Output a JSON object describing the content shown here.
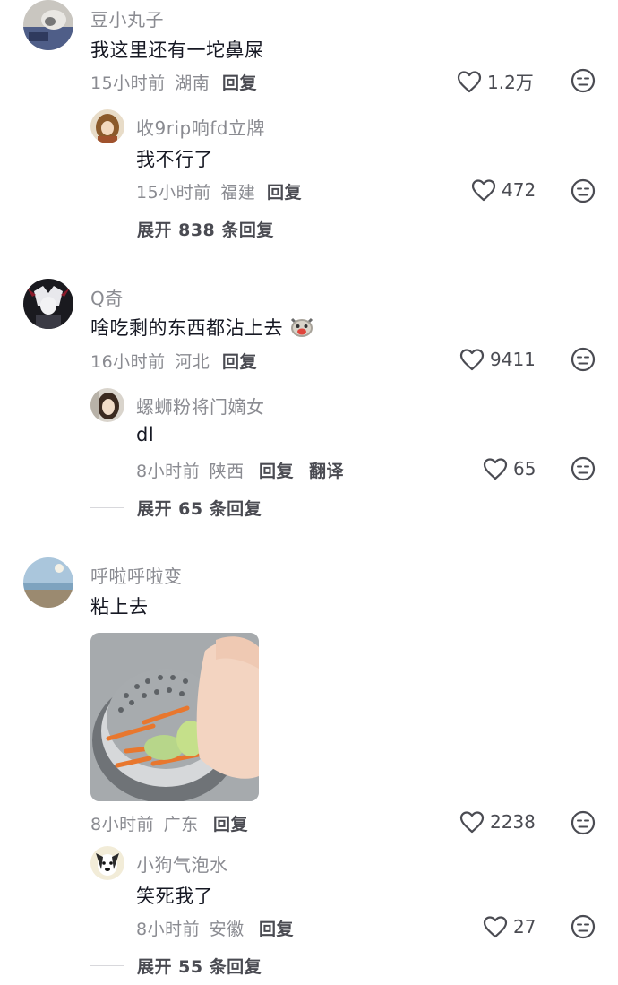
{
  "comments": [
    {
      "username": "豆小丸子",
      "text": "我这里还有一坨鼻屎",
      "time": "15小时前",
      "location": "湖南",
      "reply_label": "回复",
      "likes": "1.2万",
      "avatar_icon": "cat-photo-avatar",
      "replies": [
        {
          "username": "收9rip响fd立牌",
          "text": "我不行了",
          "time": "15小时前",
          "location": "福建",
          "reply_label": "回复",
          "likes": "472",
          "avatar_icon": "anime-character-avatar"
        }
      ],
      "expand_label": "展开 838 条回复"
    },
    {
      "username": "Q奇",
      "text": "啥吃剩的东西都沾上去",
      "text_emoji": "crying-cat-emoji",
      "time": "16小时前",
      "location": "河北",
      "reply_label": "回复",
      "likes": "9411",
      "avatar_icon": "dark-anime-avatar",
      "replies": [
        {
          "username": "螺蛳粉将门嫡女",
          "text": "dl",
          "time": "8小时前",
          "location": "陕西",
          "reply_label": "回复",
          "translate_label": "翻译",
          "likes": "65",
          "avatar_icon": "girl-photo-avatar"
        }
      ],
      "expand_label": "展开 65 条回复"
    },
    {
      "username": "呼啦呼啦变",
      "text": "粘上去",
      "image_icon": "sink-strainer-photo",
      "time": "8小时前",
      "location": "广东",
      "reply_label": "回复",
      "likes": "2238",
      "avatar_icon": "beach-photo-avatar",
      "replies": [
        {
          "username": "小狗气泡水",
          "text": "笑死我了",
          "time": "8小时前",
          "location": "安徽",
          "reply_label": "回复",
          "likes": "27",
          "avatar_icon": "puppy-avatar"
        }
      ],
      "expand_label": "展开 55 条回复"
    }
  ],
  "colors": {
    "username": "#8a8b91",
    "body_text": "#161823",
    "meta": "#8a8b91",
    "action": "#4a4b52",
    "divider": "#d8d8dc"
  }
}
